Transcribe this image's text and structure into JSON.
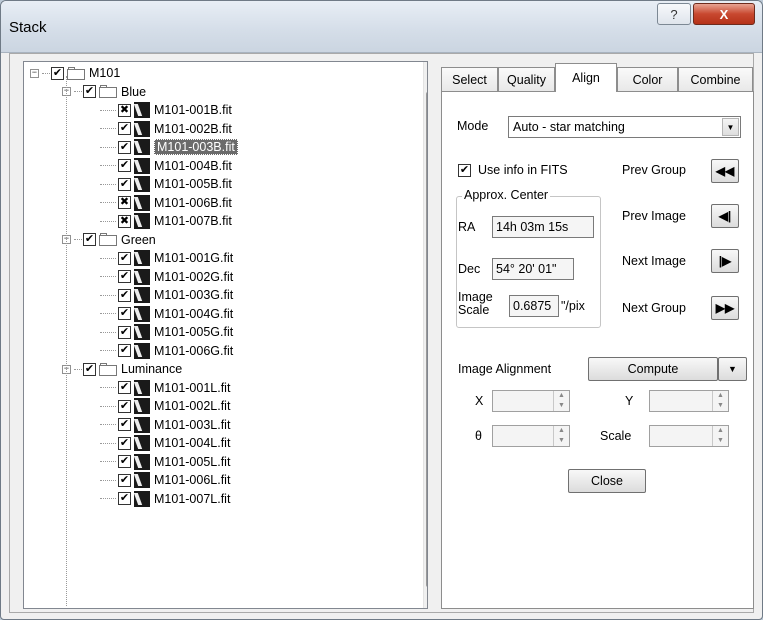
{
  "window": {
    "title": "Stack",
    "help_icon": "?",
    "close_icon": "X"
  },
  "tree": {
    "root": {
      "label": "M101",
      "expander": "⊟",
      "checked": "✔"
    },
    "groups": [
      {
        "label": "Blue",
        "files": [
          {
            "name": "M101-001B.fit",
            "state": "x"
          },
          {
            "name": "M101-002B.fit",
            "state": "check"
          },
          {
            "name": "M101-003B.fit",
            "state": "check",
            "selected": true
          },
          {
            "name": "M101-004B.fit",
            "state": "check"
          },
          {
            "name": "M101-005B.fit",
            "state": "check"
          },
          {
            "name": "M101-006B.fit",
            "state": "x"
          },
          {
            "name": "M101-007B.fit",
            "state": "x"
          }
        ]
      },
      {
        "label": "Green",
        "files": [
          {
            "name": "M101-001G.fit",
            "state": "check"
          },
          {
            "name": "M101-002G.fit",
            "state": "check"
          },
          {
            "name": "M101-003G.fit",
            "state": "check"
          },
          {
            "name": "M101-004G.fit",
            "state": "check"
          },
          {
            "name": "M101-005G.fit",
            "state": "check"
          },
          {
            "name": "M101-006G.fit",
            "state": "check"
          }
        ]
      },
      {
        "label": "Luminance",
        "files": [
          {
            "name": "M101-001L.fit",
            "state": "check"
          },
          {
            "name": "M101-002L.fit",
            "state": "check"
          },
          {
            "name": "M101-003L.fit",
            "state": "check"
          },
          {
            "name": "M101-004L.fit",
            "state": "check"
          },
          {
            "name": "M101-005L.fit",
            "state": "check"
          },
          {
            "name": "M101-006L.fit",
            "state": "check"
          },
          {
            "name": "M101-007L.fit",
            "state": "check"
          }
        ]
      }
    ]
  },
  "tabs": [
    "Select",
    "Quality",
    "Align",
    "Color",
    "Combine"
  ],
  "active_tab": "Align",
  "align": {
    "mode_label": "Mode",
    "mode_value": "Auto - star matching",
    "use_info_label": "Use info in FITS",
    "use_info_checked": true,
    "approx_center_title": "Approx. Center",
    "ra_label": "RA",
    "ra_value": "14h 03m 15s",
    "dec_label": "Dec",
    "dec_value": "54° 20' 01\"",
    "scale_label_1": "Image",
    "scale_label_2": "Scale",
    "scale_value": "0.6875",
    "scale_unit": "\"/pix",
    "prev_group": "Prev Group",
    "prev_image": "Prev Image",
    "next_image": "Next Image",
    "next_group": "Next Group",
    "image_alignment_label": "Image Alignment",
    "compute_label": "Compute",
    "x_label": "X",
    "y_label": "Y",
    "theta_label": "θ",
    "scale_param_label": "Scale",
    "close_label": "Close"
  }
}
